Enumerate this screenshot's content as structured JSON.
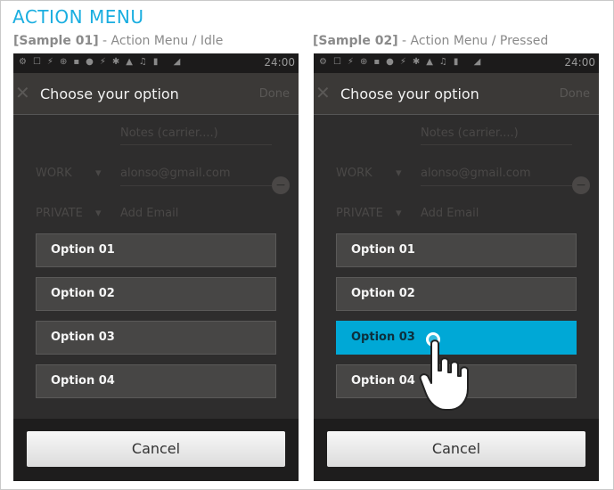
{
  "page": {
    "title": "ACTION MENU"
  },
  "colors": {
    "accent": "#00a8d6",
    "title_blue": "#1aaee0",
    "panel_dark": "#2e2d2d"
  },
  "samples": [
    {
      "caption_bold": "[Sample 01]",
      "caption_rest": " - Action Menu / Idle",
      "status_time": "24:00",
      "sheet_title": "Choose your option",
      "background": {
        "notes_placeholder": "Notes (carrier....)",
        "work_label": "WORK",
        "email_value": "alonso@gmail.com",
        "private_label": "PRIVATE",
        "add_email_placeholder": "Add Email",
        "done_label": "Done"
      },
      "options": [
        {
          "label": "Option 01",
          "pressed": false
        },
        {
          "label": "Option 02",
          "pressed": false
        },
        {
          "label": "Option 03",
          "pressed": false
        },
        {
          "label": "Option 04",
          "pressed": false
        }
      ],
      "cancel_label": "Cancel"
    },
    {
      "caption_bold": "[Sample 02]",
      "caption_rest": " - Action Menu / Pressed",
      "status_time": "24:00",
      "sheet_title": "Choose your option",
      "background": {
        "notes_placeholder": "Notes (carrier....)",
        "work_label": "WORK",
        "email_value": "alonso@gmail.com",
        "private_label": "PRIVATE",
        "add_email_placeholder": "Add Email",
        "done_label": "Done"
      },
      "options": [
        {
          "label": "Option 01",
          "pressed": false
        },
        {
          "label": "Option 02",
          "pressed": false
        },
        {
          "label": "Option 03",
          "pressed": true
        },
        {
          "label": "Option 04",
          "pressed": false
        }
      ],
      "cancel_label": "Cancel",
      "gesture_icon": "tap-hand-icon"
    }
  ]
}
